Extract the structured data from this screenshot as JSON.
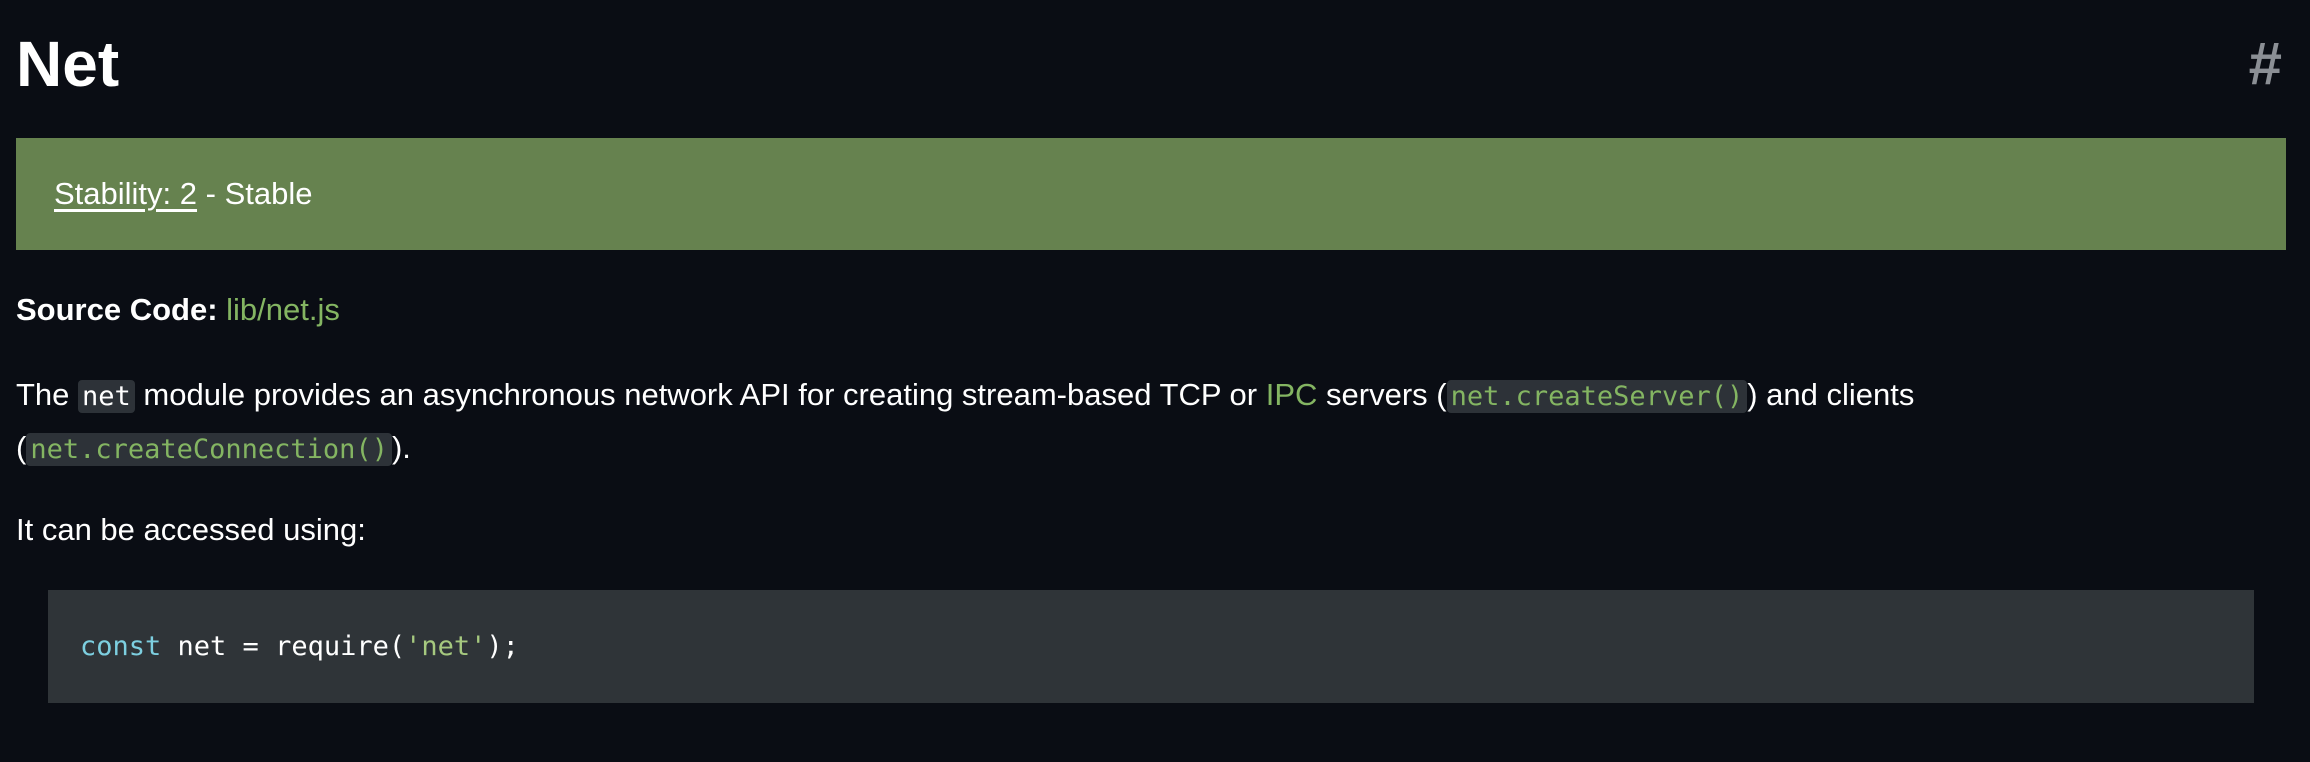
{
  "heading": {
    "title": "Net",
    "anchor": "#"
  },
  "stability": {
    "link_text": "Stability: 2",
    "suffix": " - Stable",
    "background": "#66824f"
  },
  "source": {
    "label": "Source Code:",
    "link_text": "lib/net.js"
  },
  "intro": {
    "part1": "The ",
    "code_net": "net",
    "part2": " module provides an asynchronous network API for creating stream-based TCP or ",
    "ipc_link": "IPC",
    "part3": " servers (",
    "code_create_server": "net.createServer()",
    "part4": ") and clients (",
    "code_create_connection": "net.createConnection()",
    "part5": ")."
  },
  "access": {
    "text": "It can be accessed using:"
  },
  "code_sample": {
    "keyword": "const",
    "middle": " net = require(",
    "string": "'net'",
    "end": ");"
  },
  "colors": {
    "page_background": "#0a0d14",
    "link_green": "#84b562",
    "code_background": "#2f3438",
    "keyword_blue": "#7dcfe0"
  }
}
